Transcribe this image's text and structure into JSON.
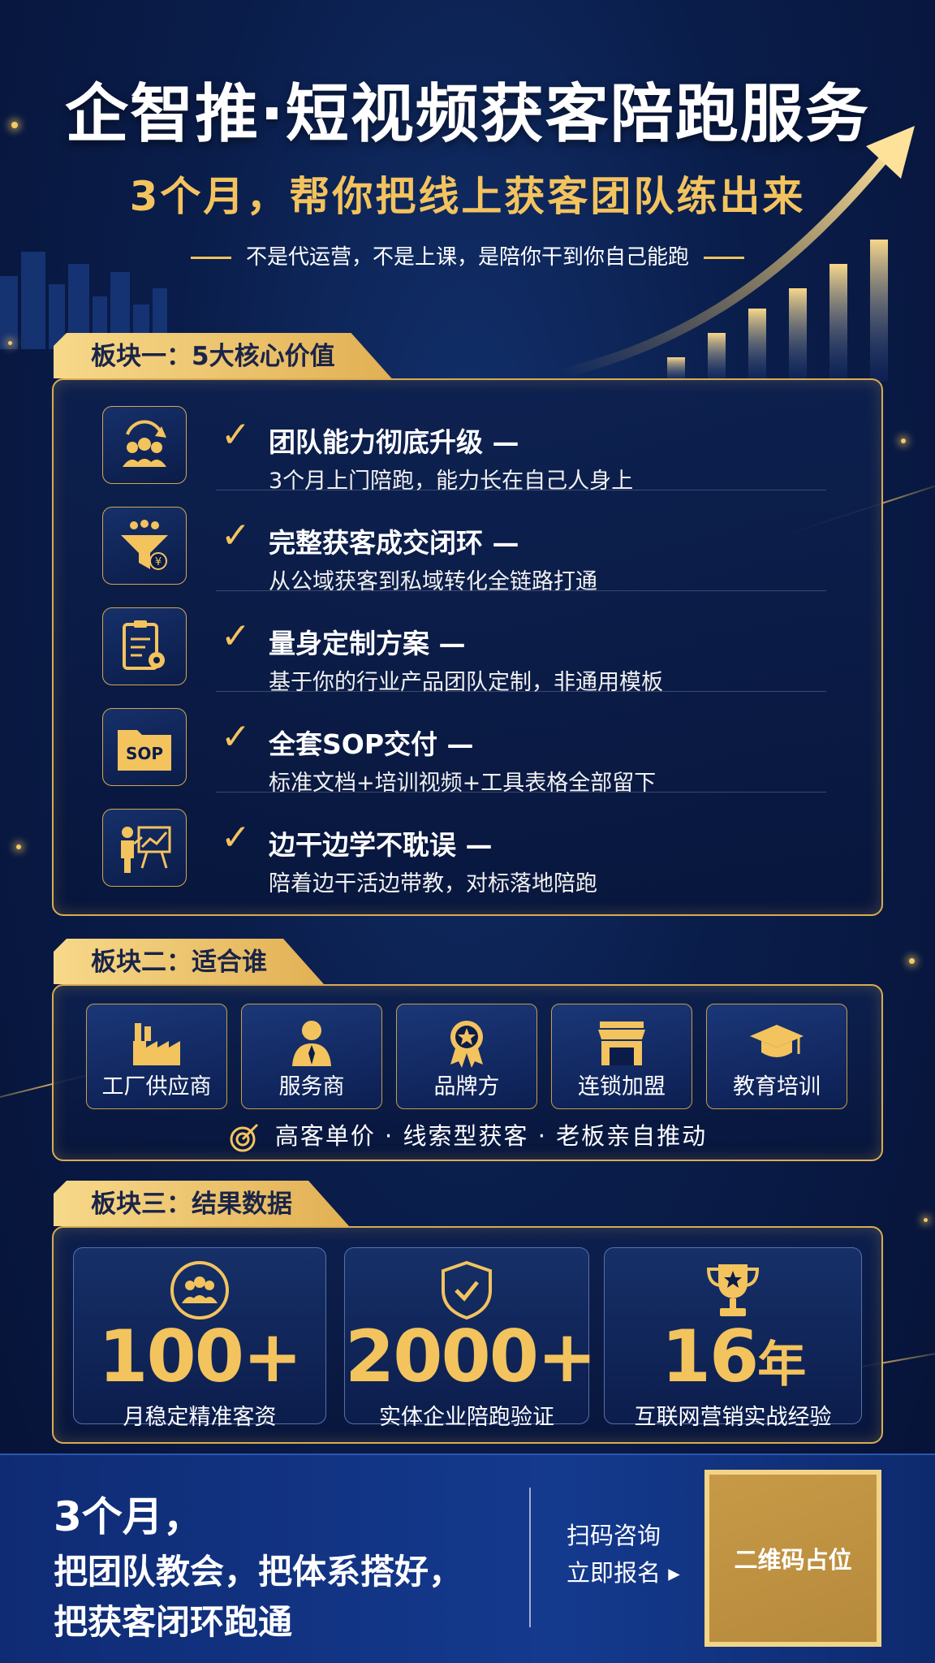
{
  "header": {
    "title": "企智推·短视频获客陪跑服务",
    "subtitle": "3个月，帮你把线上获客团队练出来",
    "tagline": "不是代运营，不是上课，是陪你干到你自己能跑"
  },
  "section1": {
    "tab": "板块一：5大核心价值",
    "items": [
      {
        "icon": "team-upgrade-icon",
        "title": "团队能力彻底升级 —",
        "desc": "3个月上门陪跑，能力长在自己人身上"
      },
      {
        "icon": "funnel-icon",
        "title": "完整获客成交闭环 —",
        "desc": "从公域获客到私域转化全链路打通"
      },
      {
        "icon": "custom-plan-icon",
        "title": "量身定制方案 —",
        "desc": "基于你的行业产品团队定制，非通用模板"
      },
      {
        "icon": "sop-folder-icon",
        "title": "全套SOP交付 —",
        "desc": "标准文档+培训视频+工具表格全部留下"
      },
      {
        "icon": "presenter-icon",
        "title": "边干边学不耽误 —",
        "desc": "陪着边干活边带教，对标落地陪跑"
      }
    ]
  },
  "section2": {
    "tab": "板块二：适合谁",
    "cards": [
      {
        "icon": "factory-icon",
        "label": "工厂供应商"
      },
      {
        "icon": "service-person-icon",
        "label": "服务商"
      },
      {
        "icon": "brand-badge-icon",
        "label": "品牌方"
      },
      {
        "icon": "storefront-icon",
        "label": "连锁加盟"
      },
      {
        "icon": "graduation-cap-icon",
        "label": "教育培训"
      }
    ],
    "tags": "高客单价 · 线索型获客 · 老板亲自推动"
  },
  "section3": {
    "tab": "板块三：结果数据",
    "stats": [
      {
        "icon": "group-circle-icon",
        "value": "100+",
        "unit": "",
        "label": "月稳定精准客资"
      },
      {
        "icon": "shield-check-icon",
        "value": "2000+",
        "unit": "",
        "label": "实体企业陪跑验证"
      },
      {
        "icon": "trophy-icon",
        "value": "16",
        "unit": "年",
        "label": "互联网营销实战经验"
      }
    ]
  },
  "footer": {
    "line1": "3个月，",
    "line2": "把团队教会，把体系搭好，",
    "line3": "把获客闭环跑通",
    "cta1": "扫码咨询",
    "cta2": "立即报名 ▸",
    "qr": "二维码占位"
  },
  "colors": {
    "gold": "#f3c35e",
    "navy": "#0a1d4a",
    "text": "#ffffff"
  }
}
